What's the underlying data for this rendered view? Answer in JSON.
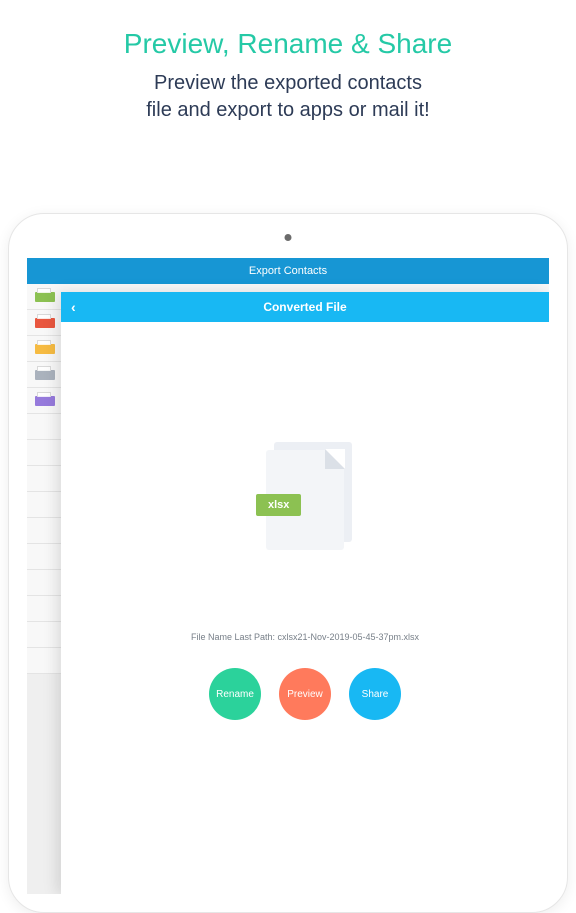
{
  "promo": {
    "title": "Preview, Rename & Share",
    "sub_line1": "Preview the exported contacts",
    "sub_line2": "file and export to apps or mail it!"
  },
  "underlay": {
    "title": "Export Contacts",
    "rows": [
      {
        "color": "#8cc152"
      },
      {
        "color": "#e9573f"
      },
      {
        "color": "#f6bb42"
      },
      {
        "color": "#aab2bd"
      },
      {
        "color": "#967adc"
      }
    ]
  },
  "sheet": {
    "title": "Converted File",
    "badge": "xlsx",
    "filepath_label": "File Name Last Path: cxlsx21-Nov-2019-05-45-37pm.xlsx",
    "buttons": {
      "rename": "Rename",
      "preview": "Preview",
      "share": "Share"
    }
  }
}
